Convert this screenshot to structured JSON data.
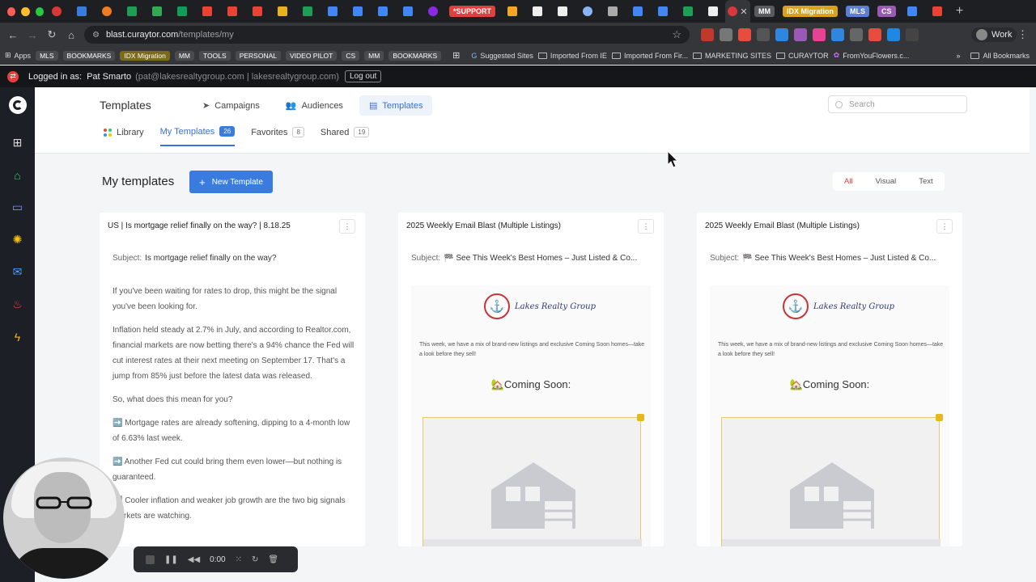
{
  "browser": {
    "tab_labels": [
      "*SUPPORT",
      "IDX Migration",
      "MM",
      "MLS",
      "CS"
    ],
    "url_host": "blast.curaytor.com",
    "url_path": "/templates/my",
    "profile": "Work"
  },
  "bookmarks": {
    "apps": "Apps",
    "chips": [
      "MLS",
      "BOOKMARKS",
      "IDX Migration",
      "MM",
      "TOOLS",
      "PERSONAL",
      "VIDEO PILOT",
      "CS",
      "MM",
      "BOOKMARKS"
    ],
    "items": [
      "Suggested Sites",
      "Imported From IE",
      "Imported From Fir...",
      "MARKETING SITES",
      "CURAYTOR",
      "FromYouFlowers.c..."
    ],
    "all": "All Bookmarks"
  },
  "login": {
    "prefix": "Logged in as:",
    "name": "Pat Smarto",
    "email": "(pat@lakesrealtygroup.com | lakesrealtygroup.com)",
    "logout": "Log out"
  },
  "header": {
    "title": "Templates",
    "nav": [
      "Campaigns",
      "Audiences",
      "Templates"
    ],
    "search_placeholder": "Search"
  },
  "subtabs": {
    "library": "Library",
    "my_templates": "My Templates",
    "my_templates_count": "26",
    "favorites": "Favorites",
    "favorites_count": "8",
    "shared": "Shared",
    "shared_count": "19"
  },
  "content": {
    "title": "My templates",
    "new_button": "New Template",
    "filters": [
      "All",
      "Visual",
      "Text"
    ]
  },
  "cards": [
    {
      "title": "US | Is mortgage relief finally on the way? | 8.18.25",
      "subject_label": "Subject:",
      "subject": "Is mortgage relief finally on the way?",
      "paragraphs": [
        "If you've been waiting for rates to drop, this might be the signal you've been looking for.",
        "Inflation held steady at 2.7% in July, and according to Realtor.com, financial markets are now betting there's a 94% chance the Fed will cut interest rates at their next meeting on September 17. That's a jump from 85% just before the latest data was released.",
        "So, what does this mean for you?",
        "➡️ Mortgage rates are already softening, dipping to a 4-month low of 6.63% last week.",
        "➡️ Another Fed cut could bring them even lower—but nothing is guaranteed.",
        "➡️ Cooler inflation and weaker job growth are the two big signals markets are watching."
      ]
    },
    {
      "title": "2025 Weekly Email Blast (Multiple Listings)",
      "subject_label": "Subject:",
      "subject": "🏁 See This Week's Best Homes – Just Listed & Co...",
      "brand": "Lakes Realty Group",
      "intro": "This week, we have a mix of brand-new listings and exclusive Coming Soon homes—take a look before they sell!",
      "heading": "🏡Coming Soon:"
    },
    {
      "title": "2025 Weekly Email Blast (Multiple Listings)",
      "subject_label": "Subject:",
      "subject": "🏁 See This Week's Best Homes – Just Listed & Co...",
      "brand": "Lakes Realty Group",
      "intro": "This week, we have a mix of brand-new listings and exclusive Coming Soon homes—take a look before they sell!",
      "heading": "🏡Coming Soon:"
    }
  ],
  "recorder": {
    "time": "0:00"
  },
  "colors": {
    "accent": "#3a7be0",
    "danger": "#e0413d",
    "rail": "#1c1f26"
  }
}
